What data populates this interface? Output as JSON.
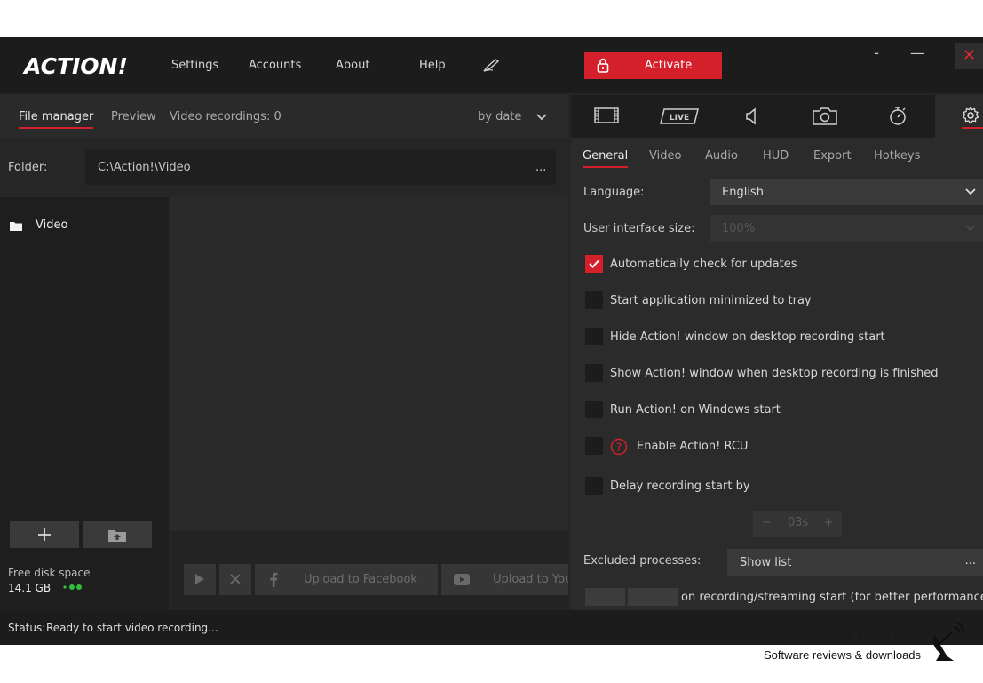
{
  "app": {
    "logo": "ACTION!"
  },
  "menu": {
    "settings": "Settings",
    "accounts": "Accounts",
    "about": "About",
    "help": "Help"
  },
  "activate": {
    "label": "Activate"
  },
  "window": {
    "minimize_small": "-",
    "minimize": "—",
    "close": "✕"
  },
  "file_manager": {
    "tabs": {
      "file_manager": "File manager",
      "preview": "Preview",
      "recordings": "Video recordings: 0"
    },
    "sort": "by date",
    "folder_label": "Folder:",
    "folder_path": "C:\\Action!\\Video",
    "folder_more": "...",
    "tree_item": "Video",
    "disk_label": "Free disk space",
    "disk_value": "14.1 GB",
    "upload_facebook": "Upload to Facebook",
    "upload_youtube": "Upload to YouTube"
  },
  "settings": {
    "tabs": {
      "general": "General",
      "video": "Video",
      "audio": "Audio",
      "hud": "HUD",
      "export": "Export",
      "hotkeys": "Hotkeys"
    },
    "language_label": "Language:",
    "language_value": "English",
    "ui_size_label": "User interface size:",
    "ui_size_value": "100%",
    "options": {
      "auto_update": "Automatically check for updates",
      "minimized": "Start application minimized to tray",
      "hide_window": "Hide Action! window on desktop recording start",
      "show_window": "Show Action! window when desktop recording is finished",
      "run_on_start": "Run Action! on Windows start",
      "rcu": "Enable Action! RCU",
      "delay": "Delay recording start by"
    },
    "delay_value": "03s",
    "delay_minus": "−",
    "delay_plus": "+",
    "excluded_label": "Excluded processes:",
    "excluded_value": "Show list",
    "excluded_more": "...",
    "perf_text": "on recording/streaming start (for better performance)"
  },
  "status": {
    "label": "Status:",
    "text": "Ready to start video recording..."
  },
  "watermark": {
    "brand": "SoftRadar.com",
    "tagline": "Software reviews & downloads"
  },
  "colors": {
    "accent": "#d3202b",
    "bg": "#262626",
    "titlebar": "#1c1c1c"
  }
}
